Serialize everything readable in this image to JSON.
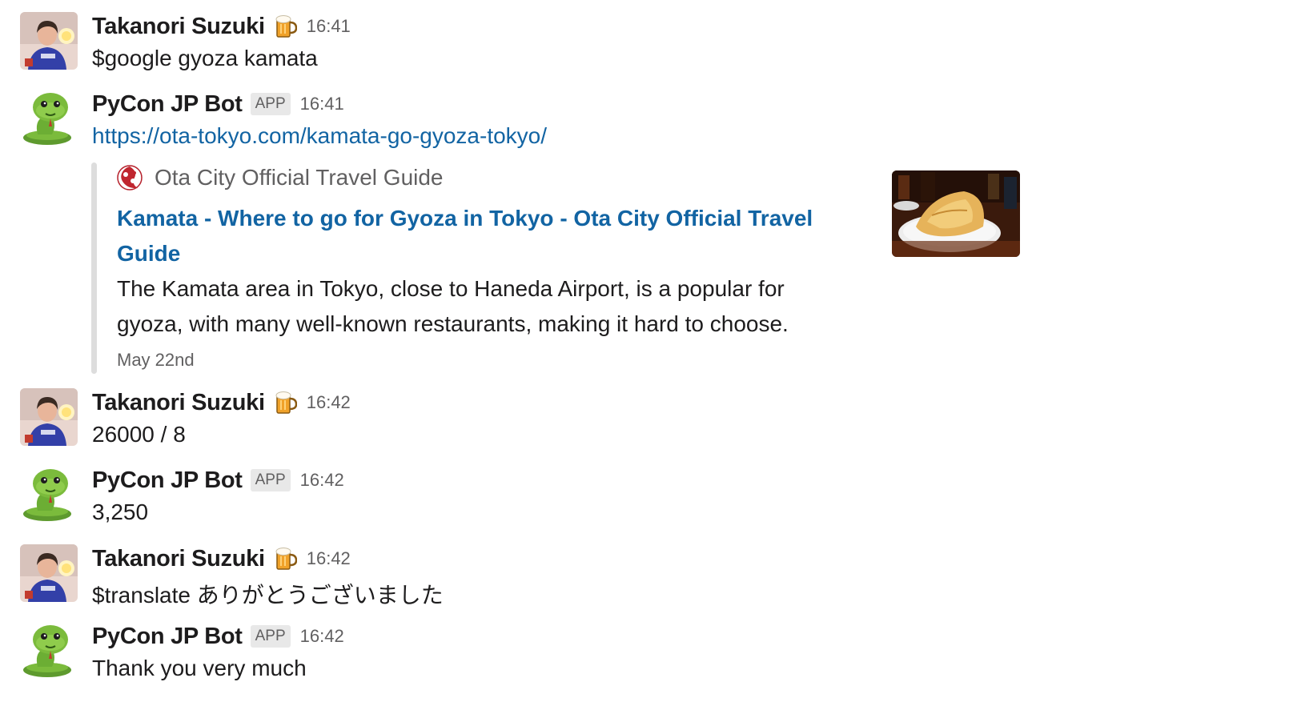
{
  "messages": [
    {
      "author": "Takanori Suzuki",
      "avatar_icon": "user-photo-avatar",
      "status_emoji": "beer-mug-icon",
      "time": "16:41",
      "text": "$google gyoza kamata"
    },
    {
      "author": "PyCon JP Bot",
      "avatar_icon": "snake-bot-avatar",
      "badge": "APP",
      "time": "16:41",
      "link": "https://ota-tokyo.com/kamata-go-gyoza-tokyo/",
      "unfurl": {
        "site_name": "Ota City Official Travel Guide",
        "site_icon": "ota-city-logo-icon",
        "title": "Kamata - Where to go for Gyoza in Tokyo - Ota City Official Travel Guide",
        "description": "The Kamata area in Tokyo, close to Haneda Airport, is a popular for gyoza, with many well-known restaurants, making it hard to choose.",
        "date": "May 22nd",
        "thumbnail": "gyoza-plate-image"
      }
    },
    {
      "author": "Takanori Suzuki",
      "avatar_icon": "user-photo-avatar",
      "status_emoji": "beer-mug-icon",
      "time": "16:42",
      "text": "26000 / 8"
    },
    {
      "author": "PyCon JP Bot",
      "avatar_icon": "snake-bot-avatar",
      "badge": "APP",
      "time": "16:42",
      "text": "3,250"
    },
    {
      "author": "Takanori Suzuki",
      "avatar_icon": "user-photo-avatar",
      "status_emoji": "beer-mug-icon",
      "time": "16:42",
      "text": "$translate ありがとうございました"
    },
    {
      "author": "PyCon JP Bot",
      "avatar_icon": "snake-bot-avatar",
      "badge": "APP",
      "time": "16:42",
      "text": "Thank you very much"
    }
  ],
  "colors": {
    "link": "#1264a3",
    "name": "#1d1c1d",
    "muted": "#616061",
    "attachment_bar": "#dddddd",
    "badge_bg": "#e8e8e8"
  }
}
